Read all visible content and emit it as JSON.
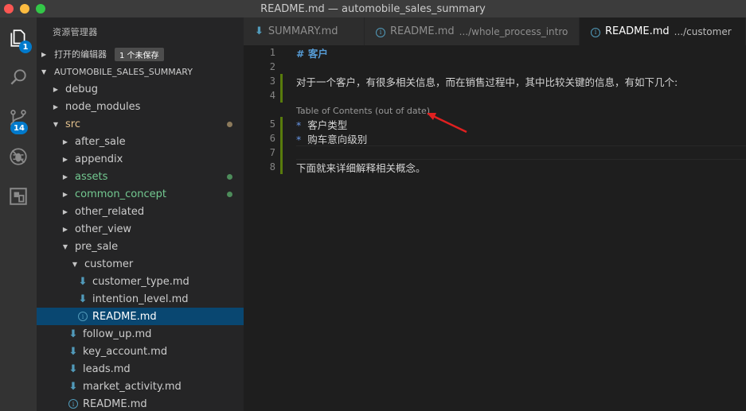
{
  "window": {
    "title": "README.md — automobile_sales_summary"
  },
  "activity_bar": {
    "explorer_badge": "1",
    "scm_badge": "14"
  },
  "sidebar": {
    "title": "资源管理器",
    "open_editors": {
      "label": "打开的编辑器",
      "unsaved_badge": "1 个未保存"
    },
    "project": "AUTOMOBILE_SALES_SUMMARY",
    "tree": [
      {
        "label": "debug"
      },
      {
        "label": "node_modules"
      },
      {
        "label": "src"
      },
      {
        "label": "after_sale"
      },
      {
        "label": "appendix"
      },
      {
        "label": "assets"
      },
      {
        "label": "common_concept"
      },
      {
        "label": "other_related"
      },
      {
        "label": "other_view"
      },
      {
        "label": "pre_sale"
      },
      {
        "label": "customer"
      },
      {
        "label": "customer_type.md"
      },
      {
        "label": "intention_level.md"
      },
      {
        "label": "README.md"
      },
      {
        "label": "follow_up.md"
      },
      {
        "label": "key_account.md"
      },
      {
        "label": "leads.md"
      },
      {
        "label": "market_activity.md"
      },
      {
        "label": "README.md"
      }
    ]
  },
  "tabs": [
    {
      "label": "SUMMARY.md",
      "desc": ""
    },
    {
      "label": "README.md",
      "desc": ".../whole_process_intro"
    },
    {
      "label": "README.md",
      "desc": ".../customer"
    }
  ],
  "editor": {
    "lines": [
      {
        "num": "1",
        "text": "# 客户"
      },
      {
        "num": "2",
        "text": ""
      },
      {
        "num": "3",
        "text": "对于一个客户，有很多相关信息，而在销售过程中，其中比较关键的信息，有如下几个:"
      },
      {
        "num": "4",
        "text": ""
      },
      {
        "num": "5",
        "text": "客户类型"
      },
      {
        "num": "6",
        "text": "购车意向级别"
      },
      {
        "num": "7",
        "text": ""
      },
      {
        "num": "8",
        "text": "下面就来详细解释相关概念。"
      }
    ],
    "toc_lens": "Table of Contents (out of date)",
    "bullet_char": "*"
  },
  "colors": {
    "accent": "#007acc",
    "selection": "#094771",
    "git_modified_gutter": "#587c0c",
    "annotation_arrow": "#e02020"
  }
}
